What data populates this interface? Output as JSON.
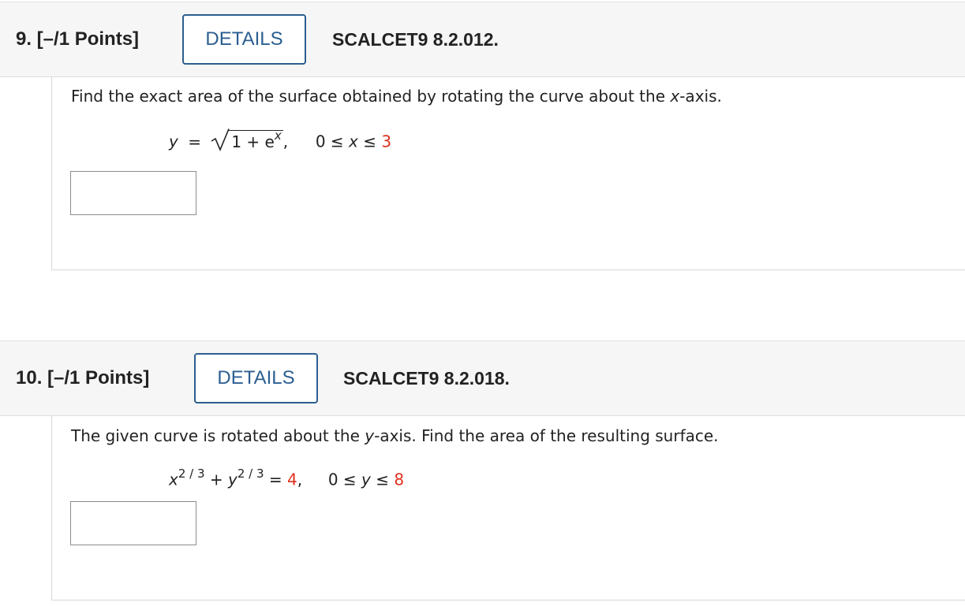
{
  "questions": [
    {
      "title": "9. [–/1 Points]",
      "details_label": "DETAILS",
      "code": "SCALCET9 8.2.012.",
      "prompt_pre": "Find the exact area of the surface obtained by rotating the curve about the ",
      "prompt_var": "x",
      "prompt_post": "-axis.",
      "equation": {
        "lhs_var": "y",
        "equals": "=",
        "radicand": "1 + e",
        "exp": "x",
        "comma": ",",
        "range_pre": "0 ≤ ",
        "range_var": "x",
        "range_mid": " ≤ ",
        "range_max": "3"
      },
      "answer_value": ""
    },
    {
      "title": "10. [–/1 Points]",
      "details_label": "DETAILS",
      "code": "SCALCET9 8.2.018.",
      "prompt_pre": "The given curve is rotated about the ",
      "prompt_var": "y",
      "prompt_post": "-axis. Find the area of the resulting surface.",
      "equation": {
        "x_var": "x",
        "x_exp": "2 / 3",
        "plus": " + ",
        "y_var": "y",
        "y_exp": "2 / 3",
        "equals": " = ",
        "rhs": "4",
        "comma": ",",
        "range_pre": "0 ≤ ",
        "range_var": "y",
        "range_mid": " ≤ ",
        "range_max": "8"
      },
      "answer_value": ""
    }
  ],
  "colors": {
    "details_border": "#2c5e8f",
    "details_text": "#2b5e91",
    "highlight_red": "#e0301e",
    "header_bg": "#f6f6f6"
  }
}
